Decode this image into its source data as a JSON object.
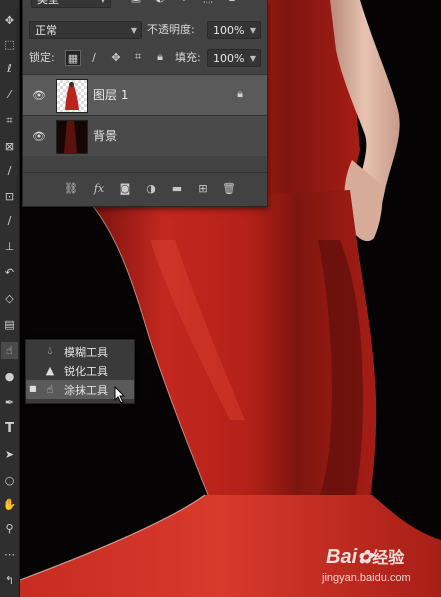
{
  "layers_panel": {
    "filter_kind": "类型",
    "blend_mode": "正常",
    "opacity_label": "不透明度:",
    "opacity_value": "100%",
    "lock_label": "锁定:",
    "fill_label": "填充:",
    "fill_value": "100%",
    "layers": [
      {
        "name": "图层 1",
        "selected": true,
        "locked": true
      },
      {
        "name": "背景",
        "selected": false,
        "locked": false
      }
    ],
    "footer_icons": [
      "link-icon",
      "fx-icon",
      "mask-icon",
      "adjustment-icon",
      "folder-icon",
      "new-layer-icon",
      "trash-icon"
    ]
  },
  "tool_flyout": {
    "items": [
      {
        "label": "模糊工具",
        "icon": "blur-drop-icon",
        "selected": false
      },
      {
        "label": "锐化工具",
        "icon": "sharpen-triangle-icon",
        "selected": false
      },
      {
        "label": "涂抹工具",
        "icon": "smudge-finger-icon",
        "selected": true
      }
    ]
  },
  "toolbar": {
    "tools": [
      "move-icon",
      "marquee-icon",
      "lasso-icon",
      "magic-wand-icon",
      "crop-icon",
      "frame-icon",
      "eyedropper-icon",
      "healing-brush-icon",
      "brush-icon",
      "clone-stamp-icon",
      "history-brush-icon",
      "eraser-icon",
      "gradient-icon",
      "smudge-icon",
      "dodge-icon",
      "pen-icon",
      "type-icon",
      "path-selection-icon",
      "shape-icon",
      "hand-icon",
      "zoom-icon",
      "more-tools-icon",
      "swap-colors-icon"
    ]
  },
  "watermark": {
    "brand": "Bai",
    "brand_suffix": "经验",
    "url": "jingyan.baidu.com"
  },
  "colors": {
    "dress_red": "#b8231b",
    "panel_bg": "#424242",
    "selected_layer": "#5a5a5a",
    "canvas_bg": "#050303"
  }
}
